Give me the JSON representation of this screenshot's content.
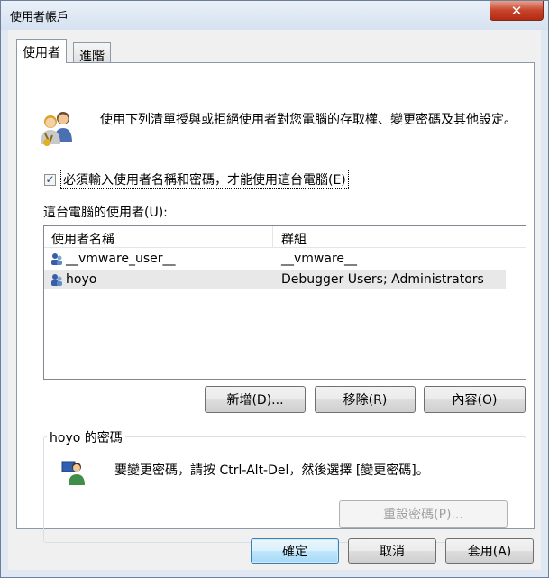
{
  "window": {
    "title": "使用者帳戶",
    "close_glyph": "✕"
  },
  "tabs": [
    {
      "label": "使用者"
    },
    {
      "label": "進階"
    }
  ],
  "description": "使用下列清單授與或拒絕使用者對您電腦的存取權、變更密碼及其他設定。",
  "require_login": {
    "checked": true,
    "check_glyph": "✓",
    "label": "必須輸入使用者名稱和密碼，才能使用這台電腦(E)"
  },
  "users_label": "這台電腦的使用者(U):",
  "list": {
    "columns": [
      "使用者名稱",
      "群組"
    ],
    "rows": [
      {
        "name": "__vmware_user__",
        "group": "__vmware__"
      },
      {
        "name": "hoyo",
        "group": "Debugger Users; Administrators"
      }
    ],
    "selected_index": 1
  },
  "list_buttons": {
    "add": "新增(D)...",
    "remove": "移除(R)",
    "properties": "內容(O)"
  },
  "password_group": {
    "title": "hoyo 的密碼",
    "instruction": "要變更密碼，請按 Ctrl-Alt-Del，然後選擇 [變更密碼]。",
    "reset_button": "重設密碼(P)..."
  },
  "footer": {
    "ok": "確定",
    "cancel": "取消",
    "apply": "套用(A)"
  },
  "colors": {
    "accent": "#3c7fb1",
    "close": "#c7442b",
    "selected_row": "#e8e8e8"
  }
}
